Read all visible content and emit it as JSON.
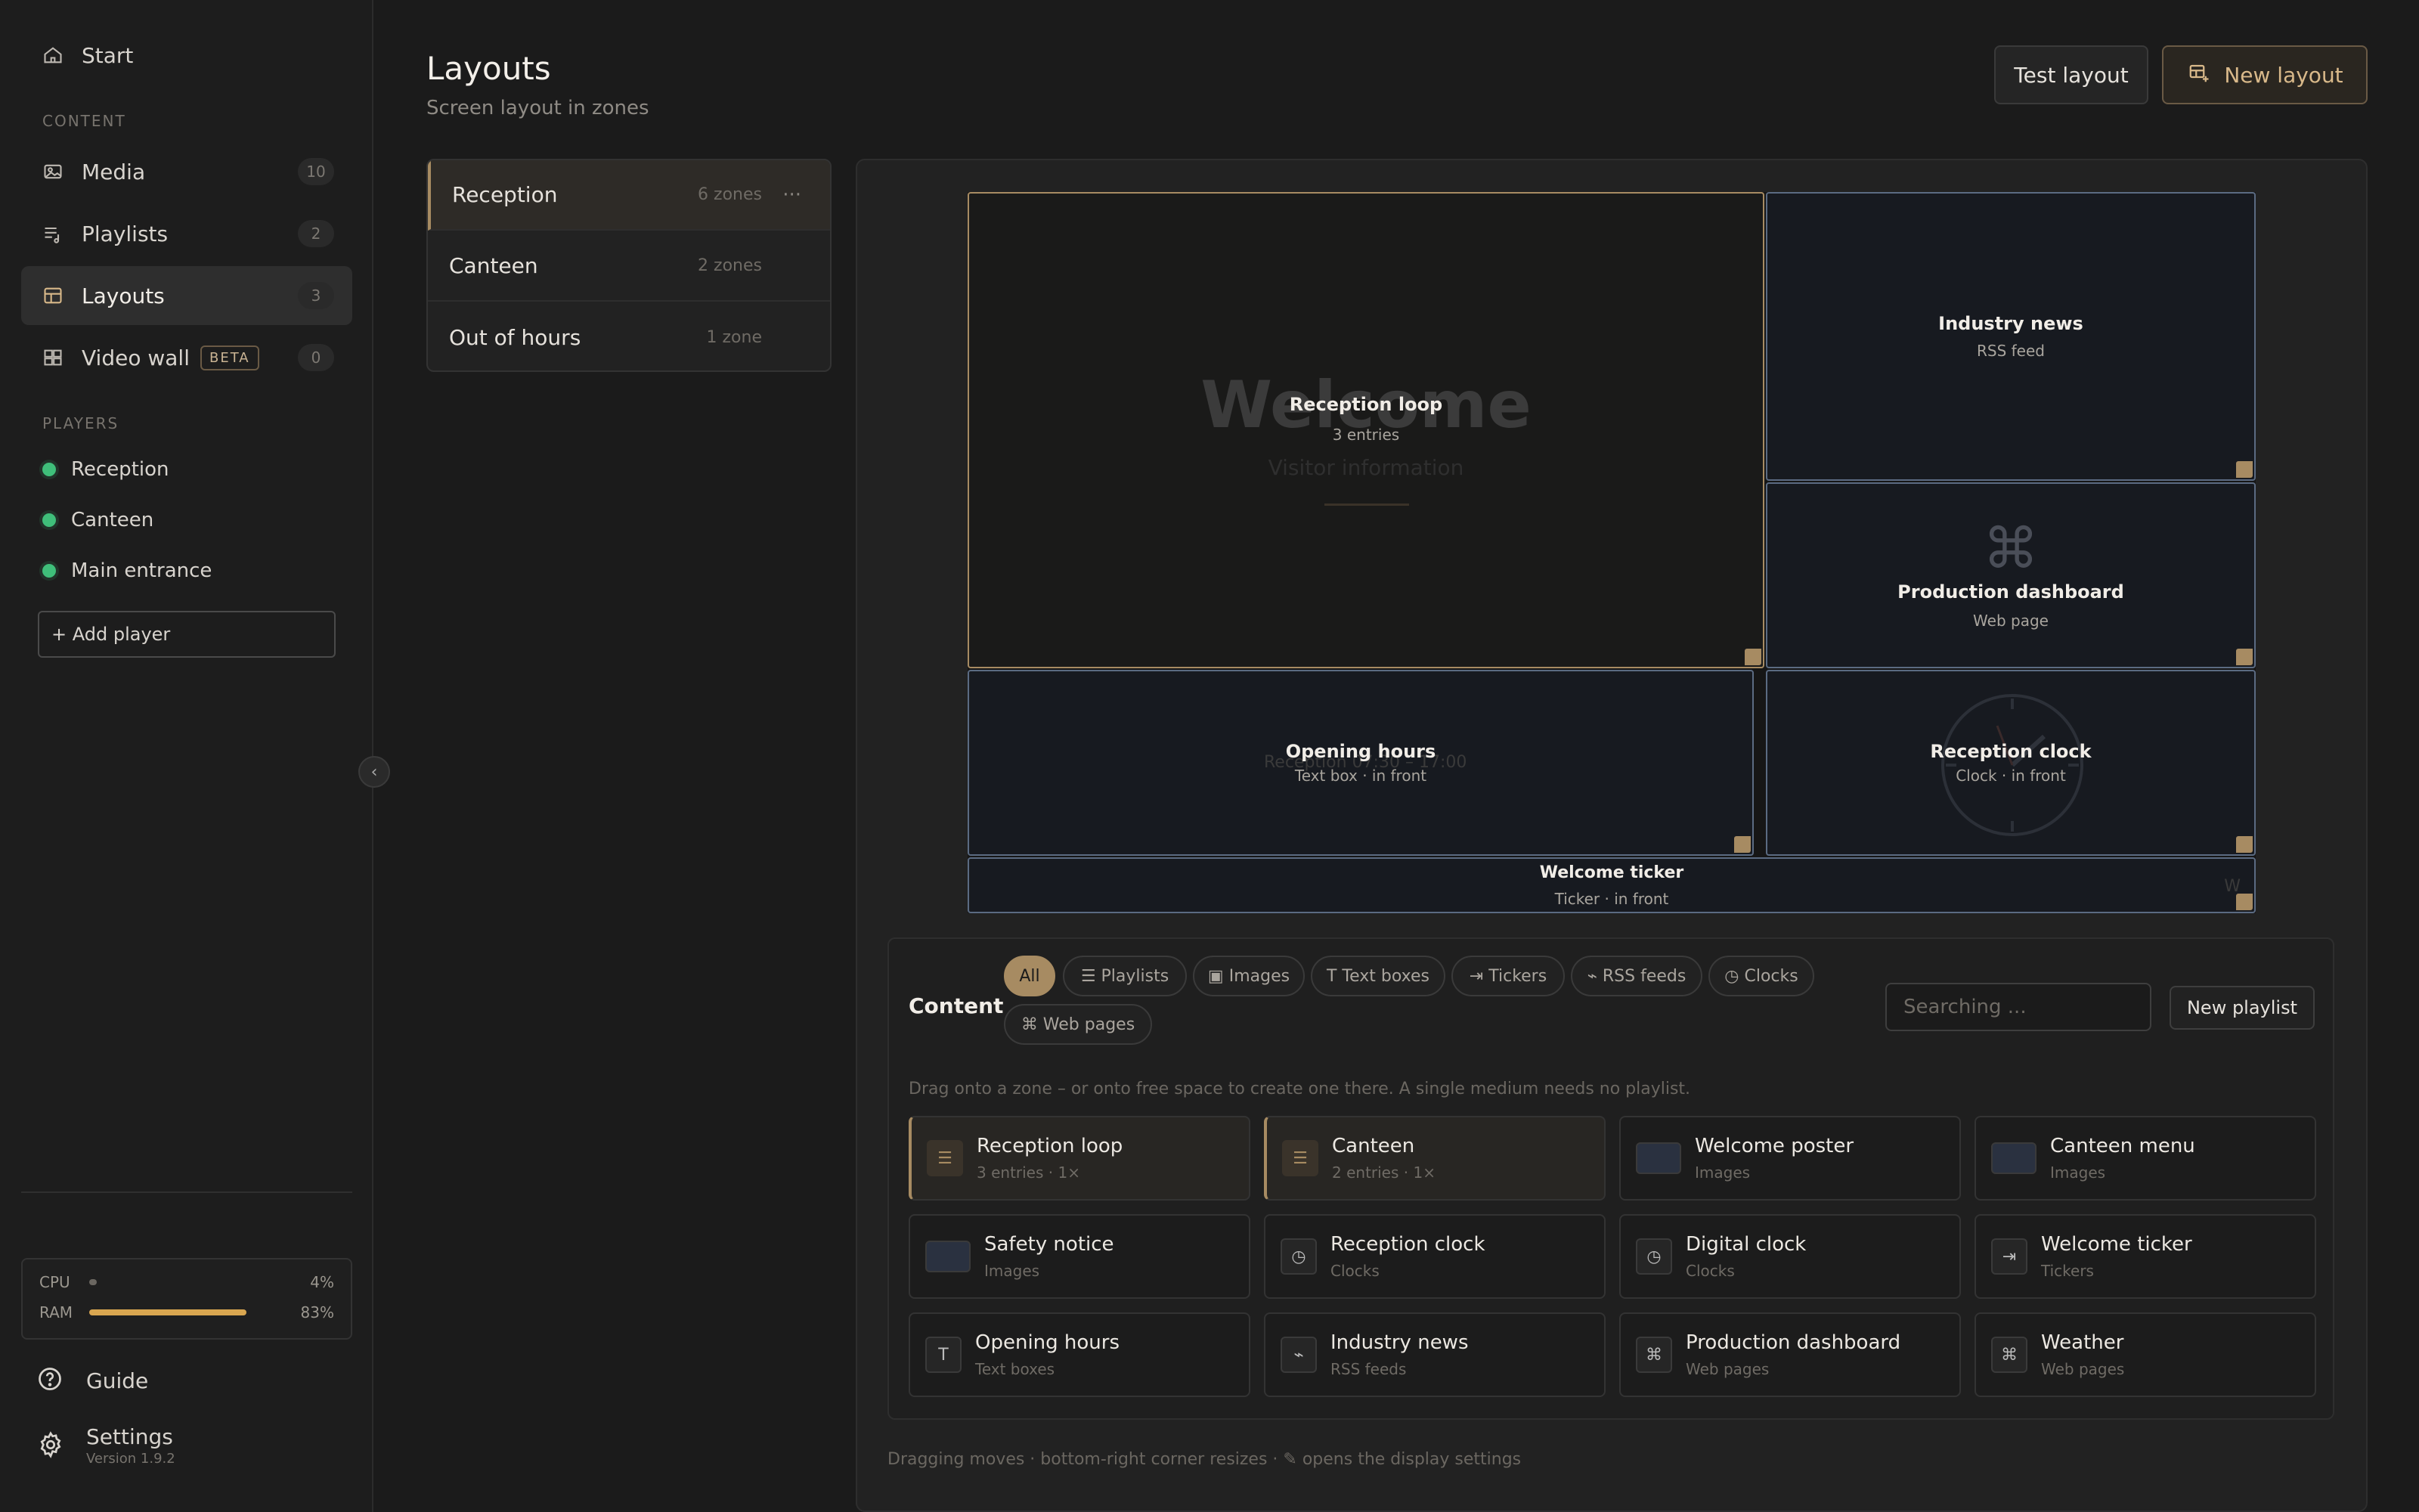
{
  "sidebar": {
    "start_label": "Start",
    "content_section": "CONTENT",
    "nav": [
      {
        "label": "Media",
        "count": "10",
        "icon": "image-icon"
      },
      {
        "label": "Playlists",
        "count": "2",
        "icon": "playlist-icon"
      },
      {
        "label": "Layouts",
        "count": "3",
        "icon": "layout-icon"
      },
      {
        "label": "Video wall",
        "count": "0",
        "badge": "BETA",
        "icon": "video-wall-icon"
      }
    ],
    "players_section": "PLAYERS",
    "players": [
      {
        "name": "Reception",
        "status_color": "#3fbf7a"
      },
      {
        "name": "Canteen",
        "status_color": "#3fbf7a"
      },
      {
        "name": "Main entrance",
        "status_color": "#3fbf7a"
      }
    ],
    "add_player_label": "+ Add player",
    "system": {
      "cpu_label": "CPU",
      "cpu_value": "4%",
      "cpu_fraction": 0.04,
      "ram_label": "RAM",
      "ram_value": "83%",
      "ram_fraction": 0.83
    },
    "guide_label": "Guide",
    "settings_label": "Settings",
    "version": "Version 1.9.2"
  },
  "header": {
    "title": "Layouts",
    "subtitle": "Screen layout in zones",
    "test_button": "Test layout",
    "new_button": "New layout"
  },
  "layouts": [
    {
      "name": "Reception",
      "zones": "6 zones",
      "more": "···"
    },
    {
      "name": "Canteen",
      "zones": "2 zones"
    },
    {
      "name": "Out of hours",
      "zones": "1 zone"
    }
  ],
  "zones": {
    "reception_loop": {
      "name": "Reception loop",
      "sub": "3 entries",
      "preview_title": "Welcome",
      "preview_sub": "Visitor information"
    },
    "industry_news": {
      "name": "Industry news",
      "sub": "RSS feed"
    },
    "production_dashboard": {
      "name": "Production dashboard",
      "sub": "Web page",
      "glyph": "⌘"
    },
    "opening_hours": {
      "name": "Opening hours",
      "sub": "Text box · in front",
      "preview": "Reception 07:30 – 17:00"
    },
    "reception_clock": {
      "name": "Reception clock",
      "sub": "Clock · in front"
    },
    "welcome_ticker": {
      "name": "Welcome ticker",
      "sub": "Ticker · in front",
      "preview": "W"
    }
  },
  "library": {
    "title": "Content",
    "filters": [
      "All",
      "☰ Playlists",
      "▣ Images",
      "T Text boxes",
      "⇥ Tickers",
      "⌁ RSS feeds",
      "◷ Clocks",
      "⌘ Web pages"
    ],
    "search_placeholder": "Searching ...",
    "new_playlist": "New playlist",
    "hint": "Drag onto a zone – or onto free space to create one there. A single medium needs no playlist.",
    "items": [
      {
        "name": "Reception loop",
        "sub": "3 entries · 1×",
        "glyph": "☰",
        "kind": "playlist"
      },
      {
        "name": "Canteen",
        "sub": "2 entries · 1×",
        "glyph": "☰",
        "kind": "playlist"
      },
      {
        "name": "Welcome poster",
        "sub": "Images",
        "glyph": "",
        "kind": "image"
      },
      {
        "name": "Canteen menu",
        "sub": "Images",
        "glyph": "",
        "kind": "image"
      },
      {
        "name": "Safety notice",
        "sub": "Images",
        "glyph": "",
        "kind": "image"
      },
      {
        "name": "Reception clock",
        "sub": "Clocks",
        "glyph": "◷",
        "kind": "clock"
      },
      {
        "name": "Digital clock",
        "sub": "Clocks",
        "glyph": "◷",
        "kind": "clock"
      },
      {
        "name": "Welcome ticker",
        "sub": "Tickers",
        "glyph": "⇥",
        "kind": "ticker"
      },
      {
        "name": "Opening hours",
        "sub": "Text boxes",
        "glyph": "T",
        "kind": "text"
      },
      {
        "name": "Industry news",
        "sub": "RSS feeds",
        "glyph": "⌁",
        "kind": "rss"
      },
      {
        "name": "Production dashboard",
        "sub": "Web pages",
        "glyph": "⌘",
        "kind": "web"
      },
      {
        "name": "Weather",
        "sub": "Web pages",
        "glyph": "⌘",
        "kind": "web"
      }
    ]
  },
  "editor_hint": "Dragging moves · bottom-right corner resizes · ✎ opens the display settings",
  "colors": {
    "accent": "#a78b62",
    "online": "#3fbf7a",
    "ram_bar": "#d9a650",
    "zone_border": "#5b6b82"
  }
}
